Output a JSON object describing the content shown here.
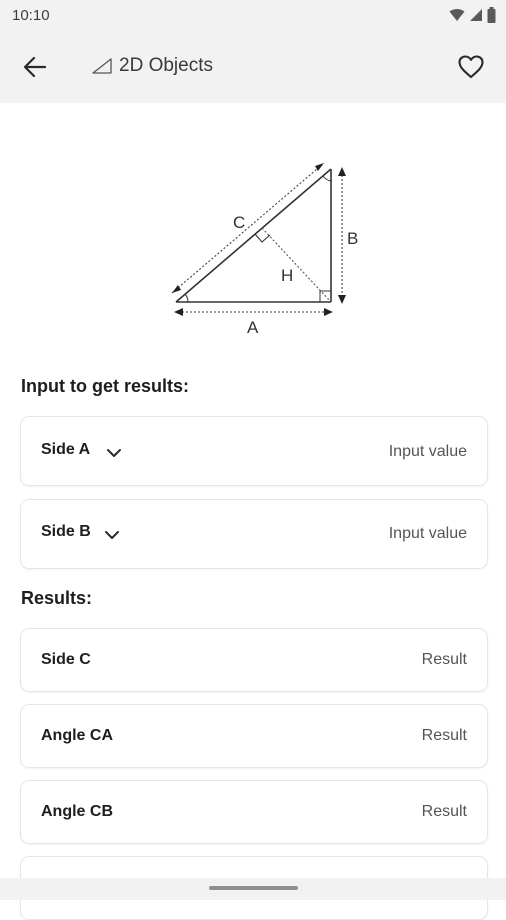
{
  "status": {
    "time": "10:10",
    "icons": [
      "wifi-icon",
      "signal-icon",
      "battery-icon"
    ]
  },
  "appbar": {
    "title": "2D Objects",
    "back_icon": "arrow-left-icon",
    "title_icon": "triangle-icon",
    "favorite_icon": "heart-outline-icon"
  },
  "diagram": {
    "labels": {
      "a": "A",
      "b": "B",
      "c": "C",
      "h": "H"
    }
  },
  "input_section": {
    "title": "Input to get results:",
    "fields": [
      {
        "label": "Side A",
        "placeholder": "Input value"
      },
      {
        "label": "Side B",
        "placeholder": "Input value"
      }
    ]
  },
  "results_section": {
    "title": "Results:",
    "items": [
      {
        "label": "Side C",
        "value": "Result"
      },
      {
        "label": "Angle CA",
        "value": "Result"
      },
      {
        "label": "Angle CB",
        "value": "Result"
      }
    ]
  },
  "colors": {
    "bar_background": "#f2f2f2",
    "card_border": "#e6e6e6",
    "text_primary": "#1e1e1e",
    "text_secondary": "#555555"
  }
}
